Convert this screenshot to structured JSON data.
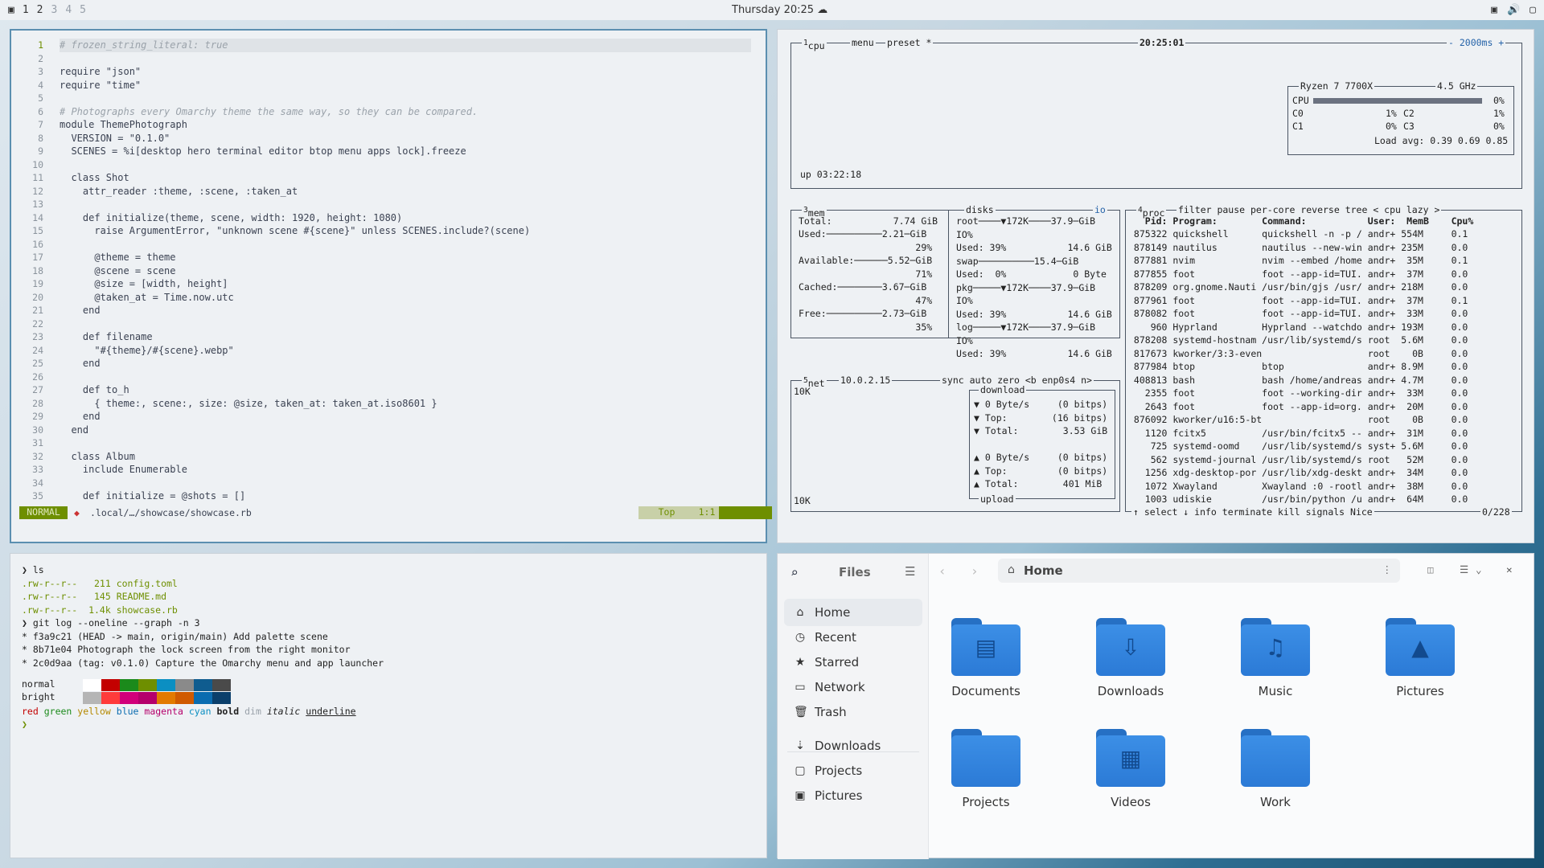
{
  "topbar": {
    "workspaces": [
      "1",
      "2",
      "3",
      "4",
      "5"
    ],
    "clock": "Thursday 20:25",
    "tray": [
      "▣",
      "🔊",
      "▢"
    ]
  },
  "editor": {
    "lines": [
      [
        "1",
        "# frozen_string_literal: true"
      ],
      [
        "2",
        ""
      ],
      [
        "3",
        "require \"json\""
      ],
      [
        "4",
        "require \"time\""
      ],
      [
        "5",
        ""
      ],
      [
        "6",
        "# Photographs every Omarchy theme the same way, so they can be compared."
      ],
      [
        "7",
        "module ThemePhotograph"
      ],
      [
        "8",
        "  VERSION = \"0.1.0\""
      ],
      [
        "9",
        "  SCENES = %i[desktop hero terminal editor btop menu apps lock].freeze"
      ],
      [
        "10",
        ""
      ],
      [
        "11",
        "  class Shot"
      ],
      [
        "12",
        "    attr_reader :theme, :scene, :taken_at"
      ],
      [
        "13",
        ""
      ],
      [
        "14",
        "    def initialize(theme, scene, width: 1920, height: 1080)"
      ],
      [
        "15",
        "      raise ArgumentError, \"unknown scene #{scene}\" unless SCENES.include?(scene)"
      ],
      [
        "16",
        ""
      ],
      [
        "17",
        "      @theme = theme"
      ],
      [
        "18",
        "      @scene = scene"
      ],
      [
        "19",
        "      @size = [width, height]"
      ],
      [
        "20",
        "      @taken_at = Time.now.utc"
      ],
      [
        "21",
        "    end"
      ],
      [
        "22",
        ""
      ],
      [
        "23",
        "    def filename"
      ],
      [
        "24",
        "      \"#{theme}/#{scene}.webp\""
      ],
      [
        "25",
        "    end"
      ],
      [
        "26",
        ""
      ],
      [
        "27",
        "    def to_h"
      ],
      [
        "28",
        "      { theme:, scene:, size: @size, taken_at: taken_at.iso8601 }"
      ],
      [
        "29",
        "    end"
      ],
      [
        "30",
        "  end"
      ],
      [
        "31",
        ""
      ],
      [
        "32",
        "  class Album"
      ],
      [
        "33",
        "    include Enumerable"
      ],
      [
        "34",
        ""
      ],
      [
        "35",
        "    def initialize = @shots = []"
      ]
    ],
    "status": {
      "mode": "NORMAL",
      "path": ".local/…/showcase/showcase.rb",
      "pos": "Top",
      "cursor": "1:1"
    }
  },
  "btop": {
    "cpu": {
      "title": "cpu",
      "menu": "menu",
      "preset": "preset *",
      "time": "20:25:01",
      "interval": "- 2000ms +",
      "uptime": "up 03:22:18",
      "model": "Ryzen 7 7700X",
      "freq": "4.5 GHz",
      "total_label": "CPU",
      "total": "0%",
      "cores": [
        {
          "n": "C0",
          "v": "1%"
        },
        {
          "n": "C2",
          "v": "1%"
        },
        {
          "n": "C1",
          "v": "0%"
        },
        {
          "n": "C3",
          "v": "0%"
        }
      ],
      "load": "Load avg: 0.39 0.69 0.85"
    },
    "mem": {
      "title": "mem",
      "total": "Total:           7.74 GiB",
      "rows": [
        "Used:──────────2.21─GiB",
        "                     29%",
        "Available:──────5.52─GiB",
        "                     71%",
        "Cached:────────3.67─GiB",
        "                     47%",
        "Free:──────────2.73─GiB",
        "                     35%"
      ]
    },
    "disks": {
      "title": "disks",
      "io": "io",
      "rows": [
        "root────▼172K────37.9─GiB",
        "IO%",
        "Used: 39%           14.6 GiB",
        "swap──────────15.4─GiB",
        "Used:  0%            0 Byte",
        "pkg─────▼172K────37.9─GiB",
        "IO%",
        "Used: 39%           14.6 GiB",
        "log─────▼172K────37.9─GiB",
        "IO%",
        "Used: 39%           14.6 GiB"
      ]
    },
    "net": {
      "title": "net",
      "ip": "10.0.2.15",
      "opts": "sync auto zero <b enp0s4 n>",
      "scale_top": "10K",
      "scale_bot": "10K",
      "download": "download",
      "upload": "upload",
      "rows": [
        "▼ 0 Byte/s     (0 bitps)",
        "▼ Top:        (16 bitps)",
        "▼ Total:        3.53 GiB",
        "",
        "▲ 0 Byte/s     (0 bitps)",
        "▲ Top:         (0 bitps)",
        "▲ Total:        401 MiB"
      ]
    },
    "proc": {
      "title": "proc",
      "opts": "filter    pause per-core reverse tree < cpu lazy >",
      "header": "   Pid: Program:        Command:           User:  MemB    Cpu%",
      "rows": [
        " 875322 quickshell      quickshell -n -p / andr+ 554M     0.1",
        " 878149 nautilus        nautilus --new-win andr+ 235M     0.0",
        " 877881 nvim            nvim --embed /home andr+  35M     0.1",
        " 877855 foot            foot --app-id=TUI. andr+  37M     0.0",
        " 878209 org.gnome.Nauti /usr/bin/gjs /usr/ andr+ 218M     0.0",
        " 877961 foot            foot --app-id=TUI. andr+  37M     0.1",
        " 878082 foot            foot --app-id=TUI. andr+  33M     0.0",
        "    960 Hyprland        Hyprland --watchdo andr+ 193M     0.0",
        " 878208 systemd-hostnam /usr/lib/systemd/s root  5.6M     0.0",
        " 817673 kworker/3:3-even                   root    0B     0.0",
        " 877984 btop            btop               andr+ 8.9M     0.0",
        " 408813 bash            bash /home/andreas andr+ 4.7M     0.0",
        "   2355 foot            foot --working-dir andr+  33M     0.0",
        "   2643 foot            foot --app-id=org. andr+  20M     0.0",
        " 876092 kworker/u16:5-bt                   root    0B     0.0",
        "   1120 fcitx5          /usr/bin/fcitx5 -- andr+  31M     0.0",
        "    725 systemd-oomd    /usr/lib/systemd/s syst+ 5.6M     0.0",
        "    562 systemd-journal /usr/lib/systemd/s root   52M     0.0",
        "   1256 xdg-desktop-por /usr/lib/xdg-deskt andr+  34M     0.0",
        "   1072 Xwayland        Xwayland :0 -rootl andr+  38M     0.0",
        "   1003 udiskie         /usr/bin/python /u andr+  64M     0.0"
      ],
      "footer": "↑ select ↓ info   terminate  kill  signals  Nice",
      "count": "0/228"
    }
  },
  "terminal": {
    "lines": [
      [
        "prompt",
        "❯ ls"
      ],
      [
        "ls",
        ".rw-r--r--   211 config.toml"
      ],
      [
        "ls",
        ".rw-r--r--   145 README.md"
      ],
      [
        "ls",
        ".rw-r--r--  1.4k showcase.rb"
      ],
      [
        "prompt",
        "❯ git log --oneline --graph -n 3"
      ],
      [
        "git",
        "* f3a9c21 (HEAD -> main, origin/main) Add palette scene"
      ],
      [
        "git",
        "* 8b71e04 Photograph the lock screen from the right monitor"
      ],
      [
        "git",
        "* 2c0d9aa (tag: v0.1.0) Capture the Omarchy menu and app launcher"
      ]
    ],
    "palette_normal_label": "normal",
    "palette_bright_label": "bright",
    "normal": [
      "#ffffff",
      "#c30000",
      "#1b8a1b",
      "#6e8f00",
      "#0b8fc2",
      "#8a8a8a",
      "#0f5c8f",
      "#4a4a4a"
    ],
    "bright": [
      "#b5b5b5",
      "#ff3b3b",
      "#d1007a",
      "#b5006b",
      "#e27a00",
      "#d05a00",
      "#0a6cb0",
      "#0b3f6b"
    ],
    "styles": [
      "red",
      "green",
      "yellow",
      "blue",
      "magenta",
      "cyan",
      "bold",
      "dim",
      "italic",
      "underline"
    ],
    "prompt_end": "❯"
  },
  "files": {
    "title": "Files",
    "location": "Home",
    "sidebar": [
      {
        "label": "Home",
        "icon": "⌂"
      },
      {
        "label": "Recent",
        "icon": "◷"
      },
      {
        "label": "Starred",
        "icon": "★"
      },
      {
        "label": "Network",
        "icon": "▭"
      },
      {
        "label": "Trash",
        "icon": "🗑"
      },
      {
        "label": "Downloads",
        "icon": "⇣"
      },
      {
        "label": "Projects",
        "icon": "▢"
      },
      {
        "label": "Pictures",
        "icon": "▣"
      }
    ],
    "folders": [
      {
        "label": "Documents",
        "glyph": "▤"
      },
      {
        "label": "Downloads",
        "glyph": "⇩"
      },
      {
        "label": "Music",
        "glyph": "♫"
      },
      {
        "label": "Pictures",
        "glyph": "▲"
      },
      {
        "label": "Projects",
        "glyph": ""
      },
      {
        "label": "Videos",
        "glyph": "▦"
      },
      {
        "label": "Work",
        "glyph": ""
      }
    ]
  }
}
